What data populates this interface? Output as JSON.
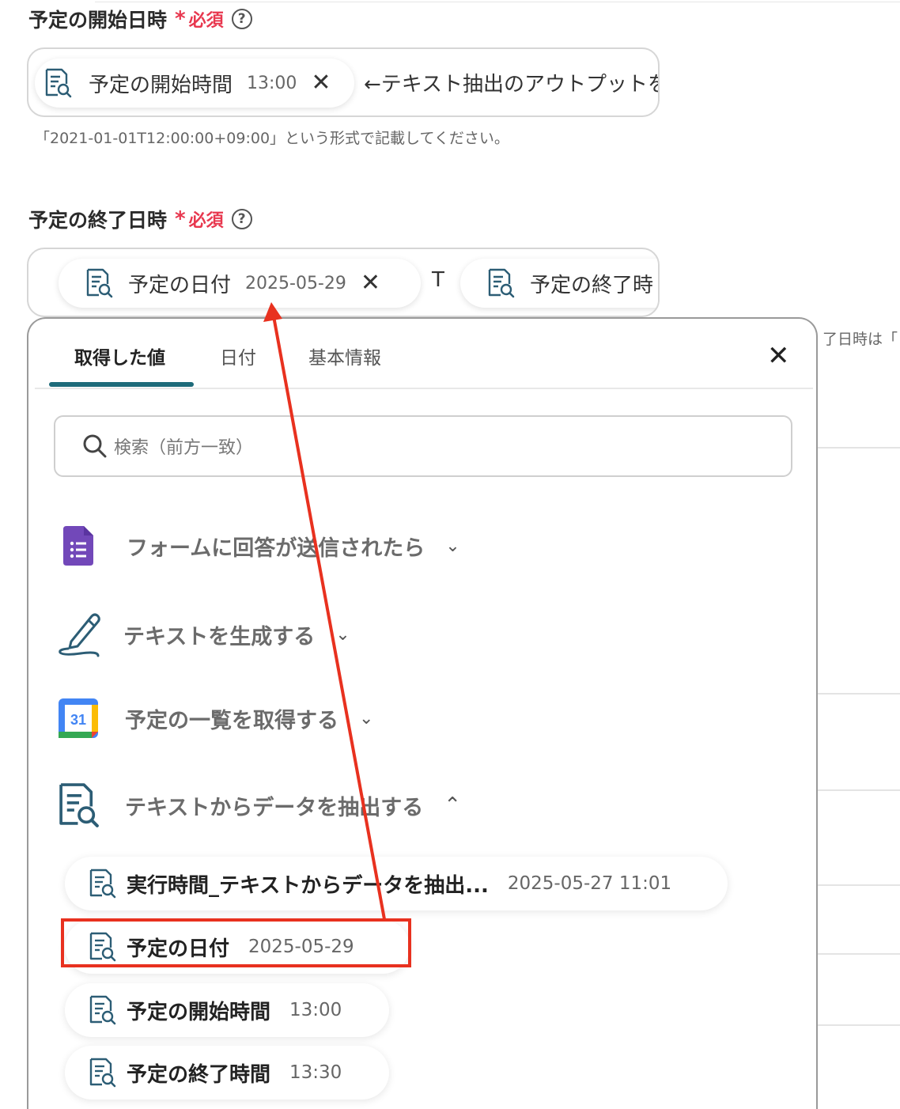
{
  "start_section": {
    "label": "予定の開始日時",
    "required_star": "*",
    "required_text": "必須",
    "help": "?",
    "chip_label": "予定の開始時間",
    "chip_value": "13:00",
    "trailing_text": "←テキスト抽出のアウトプットを",
    "hint": "「2021-01-01T12:00:00+09:00」という形式で記載してください。"
  },
  "end_section": {
    "label": "予定の終了日時",
    "required_star": "*",
    "required_text": "必須",
    "help": "?",
    "chip1_label": "予定の日付",
    "chip1_value": "2025-05-29",
    "separator": "T",
    "chip2_label": "予定の終了時",
    "hint_cutoff": "了日時は「"
  },
  "panel": {
    "tabs": [
      "取得した値",
      "日付",
      "基本情報"
    ],
    "search_placeholder": "検索（前方一致）",
    "groups": [
      {
        "label": "フォームに回答が送信されたら",
        "icon": "google-forms-icon",
        "expanded": false
      },
      {
        "label": "テキストを生成する",
        "icon": "pen-icon",
        "expanded": false
      },
      {
        "label": "予定の一覧を取得する",
        "icon": "google-calendar-icon",
        "expanded": false
      },
      {
        "label": "テキストからデータを抽出する",
        "icon": "text-extract-icon",
        "expanded": true
      }
    ],
    "calendar_day": "31",
    "items": [
      {
        "label": "実行時間_テキストからデータを抽出...",
        "value": "2025-05-27 11:01"
      },
      {
        "label": "予定の日付",
        "value": "2025-05-29"
      },
      {
        "label": "予定の開始時間",
        "value": "13:00"
      },
      {
        "label": "予定の終了時間",
        "value": "13:30"
      }
    ]
  },
  "colors": {
    "required": "#e8384f",
    "tab_underline": "#1e6b7a",
    "annotation": "#e8311f",
    "forms_purple": "#7248b9",
    "icon_teal": "#2c5d75"
  }
}
